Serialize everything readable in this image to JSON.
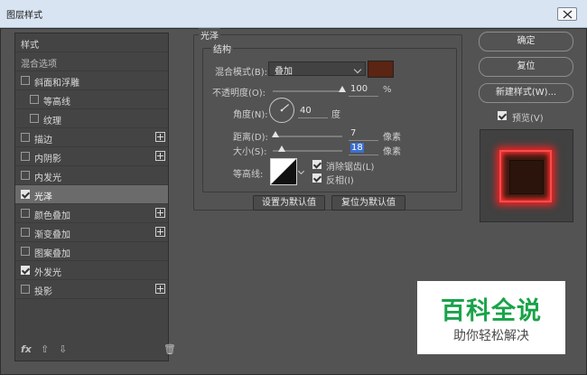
{
  "window": {
    "title": "图层样式"
  },
  "sidebar": {
    "items": [
      {
        "label": "样式",
        "checkbox": false,
        "checked": false,
        "plus": false,
        "selected": false,
        "dim": false
      },
      {
        "label": "混合选项",
        "checkbox": false,
        "checked": false,
        "plus": false,
        "selected": false,
        "dim": true
      },
      {
        "label": "斜面和浮雕",
        "checkbox": true,
        "checked": false,
        "plus": false,
        "selected": false
      },
      {
        "label": "等高线",
        "checkbox": true,
        "checked": false,
        "plus": false,
        "selected": false,
        "indent": true
      },
      {
        "label": "纹理",
        "checkbox": true,
        "checked": false,
        "plus": false,
        "selected": false,
        "indent": true
      },
      {
        "label": "描边",
        "checkbox": true,
        "checked": false,
        "plus": true,
        "selected": false
      },
      {
        "label": "内阴影",
        "checkbox": true,
        "checked": false,
        "plus": true,
        "selected": false
      },
      {
        "label": "内发光",
        "checkbox": true,
        "checked": false,
        "plus": false,
        "selected": false
      },
      {
        "label": "光泽",
        "checkbox": true,
        "checked": true,
        "plus": false,
        "selected": true
      },
      {
        "label": "颜色叠加",
        "checkbox": true,
        "checked": false,
        "plus": true,
        "selected": false
      },
      {
        "label": "渐变叠加",
        "checkbox": true,
        "checked": false,
        "plus": true,
        "selected": false
      },
      {
        "label": "图案叠加",
        "checkbox": true,
        "checked": false,
        "plus": false,
        "selected": false
      },
      {
        "label": "外发光",
        "checkbox": true,
        "checked": true,
        "plus": false,
        "selected": false
      },
      {
        "label": "投影",
        "checkbox": true,
        "checked": false,
        "plus": true,
        "selected": false
      }
    ],
    "footer": {
      "fx": "fx",
      "up": "⇧",
      "down": "⇩",
      "trash": "🗑"
    }
  },
  "satin": {
    "group_title": "光泽",
    "structure_title": "结构",
    "blend_mode_label": "混合模式(B):",
    "blend_mode_value": "叠加",
    "blend_color": "#5b2413",
    "opacity_label": "不透明度(O):",
    "opacity_value": "100",
    "opacity_unit": "%",
    "opacity_fraction": 1.0,
    "angle_label": "角度(N):",
    "angle_value": "40",
    "angle_unit": "度",
    "distance_label": "距离(D):",
    "distance_value": "7",
    "distance_unit": "像素",
    "size_label": "大小(S):",
    "size_value": "18",
    "size_unit": "像素",
    "contour_label": "等高线:",
    "antialias_label": "消除锯齿(L)",
    "antialias_checked": true,
    "invert_label": "反相(I)",
    "invert_checked": true,
    "make_default": "设置为默认值",
    "reset_default": "复位为默认值"
  },
  "buttons": {
    "ok": "确定",
    "reset": "复位",
    "new_style": "新建样式(W)...",
    "preview_label": "预览(V)",
    "preview_checked": true
  },
  "watermark": {
    "line1": "百科全说",
    "line2": "助你轻松解决"
  }
}
